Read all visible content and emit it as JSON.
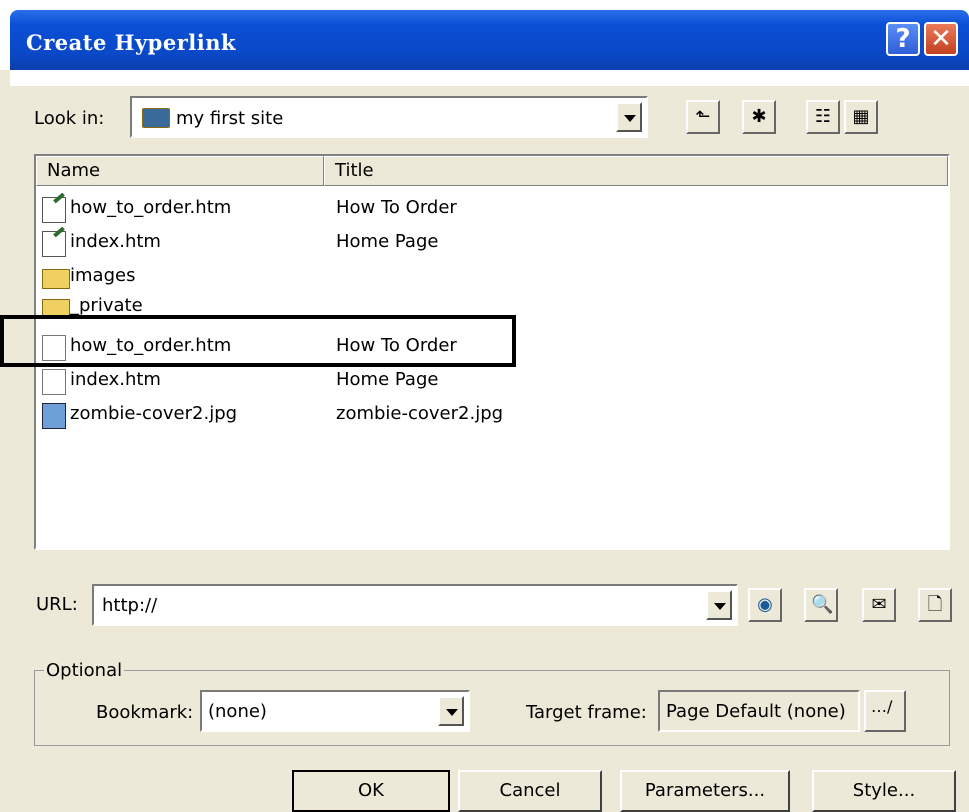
{
  "dialog": {
    "title": "Create Hyperlink",
    "help_glyph": "?",
    "close_glyph": "✕"
  },
  "look_in": {
    "label": "Look in:",
    "value": "my first site",
    "toolbar": [
      "up-one-level-icon",
      "new-folder-icon",
      "list-view-icon",
      "details-view-icon"
    ]
  },
  "file_list": {
    "columns": [
      "Name",
      "Title"
    ],
    "rows": [
      {
        "name": "how_to_order.htm",
        "title": "How To Order",
        "icon": "web-page-edit-icon"
      },
      {
        "name": "index.htm",
        "title": "Home Page",
        "icon": "web-page-edit-icon"
      },
      {
        "name": "images",
        "title": "",
        "icon": "folder-icon"
      },
      {
        "name": "_private",
        "title": "",
        "icon": "folder-icon"
      },
      {
        "name": "how_to_order.htm",
        "title": "How To Order",
        "icon": "web-page-icon"
      },
      {
        "name": "index.htm",
        "title": "Home Page",
        "icon": "web-page-icon"
      },
      {
        "name": "zombie-cover2.jpg",
        "title": "zombie-cover2.jpg",
        "icon": "image-file-icon"
      }
    ],
    "highlight_color": "#000000"
  },
  "url": {
    "label": "URL:",
    "value": "http://",
    "buttons": [
      "browse-web-icon",
      "select-file-icon",
      "email-icon",
      "new-page-icon"
    ]
  },
  "optional": {
    "group_label": "Optional",
    "bookmark_label": "Bookmark:",
    "bookmark_value": "(none)",
    "target_label": "Target frame:",
    "target_value": "Page Default (none)",
    "target_btn_glyph": "…/"
  },
  "buttons": {
    "ok": "OK",
    "cancel": "Cancel",
    "parameters": "Parameters...",
    "style": "Style..."
  }
}
